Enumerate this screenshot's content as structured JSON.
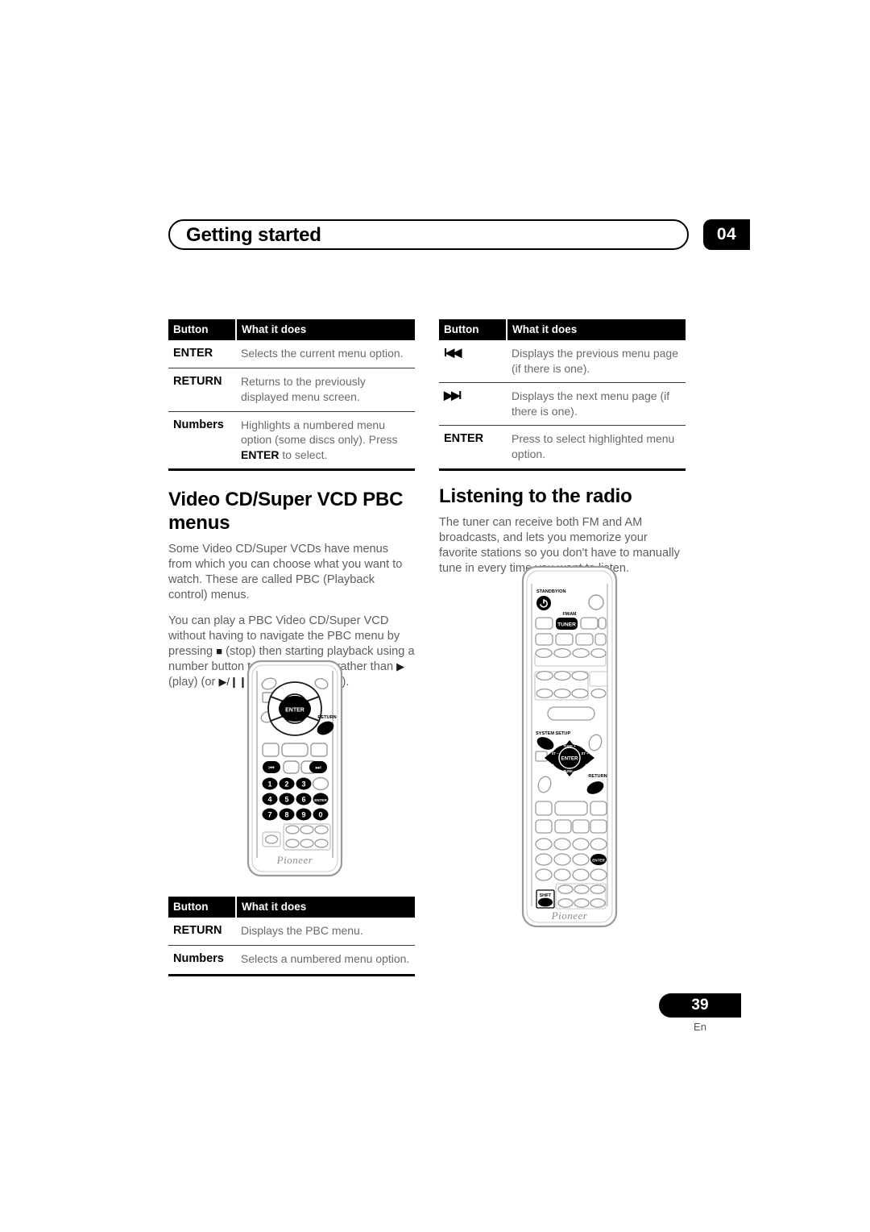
{
  "header": {
    "title": "Getting started",
    "chapter": "04"
  },
  "footer": {
    "page_number": "39",
    "language": "En"
  },
  "tables": {
    "columns": {
      "button": "Button",
      "what": "What it does"
    },
    "dvd_menu": [
      {
        "button": "ENTER",
        "desc": "Selects the current menu option.",
        "desc_bold": "",
        "desc_tail": ""
      },
      {
        "button": "RETURN",
        "desc": "Returns to the previously displayed menu screen.",
        "desc_bold": "",
        "desc_tail": ""
      },
      {
        "button": "Numbers",
        "desc": "Highlights a numbered menu option (some discs only). Press ",
        "desc_bold": "ENTER",
        "desc_tail": " to select."
      }
    ],
    "vcd_menu_right": [
      {
        "button": "Ɩ◀◀",
        "icon": "previous-track-icon",
        "desc": "Displays the previous menu page (if there is one)."
      },
      {
        "button": "▶▶Ɩ",
        "icon": "next-track-icon",
        "desc": "Displays the next menu page (if there is one)."
      },
      {
        "button": "ENTER",
        "icon": "",
        "desc": "Press to select highlighted menu option."
      }
    ],
    "pbc_menu": [
      {
        "button": "RETURN",
        "desc": "Displays the PBC menu."
      },
      {
        "button": "Numbers",
        "desc": "Selects a numbered menu option."
      }
    ]
  },
  "sections": {
    "vcd": {
      "heading": "Video CD/Super VCD PBC menus",
      "paragraph1": "Some Video CD/Super VCDs have menus from which you can choose what you want to watch. These are called PBC (Playback control) menus.",
      "p2_a": "You can play a PBC Video CD/Super VCD without having to navigate the PBC menu by pressing ",
      "p2_stop": "■",
      "p2_b": " (stop) then starting playback using a number button to select a track, rather than ",
      "p2_play": "▶",
      "p2_c": " (play) (or ",
      "p2_playpause": "▶/❙❙",
      "p2_d": " on the front panel)."
    },
    "radio": {
      "heading": "Listening to the radio",
      "paragraph1": "The tuner can receive both FM and AM broadcasts, and lets you memorize your favorite stations so you don't have to manually tune in every time you want to listen."
    }
  },
  "remote_left": {
    "name": "dvd-remote-control",
    "brand": "Pioneer",
    "labels": {
      "enter": "ENTER",
      "return": "RETURN",
      "prev": "Ɩ◀◀",
      "next": "▶▶Ɩ",
      "keypad_enter": "ENTER"
    },
    "number_keys": [
      "1",
      "2",
      "3",
      "4",
      "5",
      "6",
      "7",
      "8",
      "9",
      "0"
    ]
  },
  "remote_right": {
    "name": "tuner-remote-control",
    "brand": "Pioneer",
    "labels": {
      "standby": "STANDBY/ON",
      "fmam": "FM/AM",
      "tuner": "TUNER",
      "system_setup": "SYSTEM SETUP",
      "enter": "ENTER",
      "return": "RETURN",
      "tune_up": "TUNE +",
      "tune_down": "TUNE –",
      "st_up": "ST +",
      "st_down": "ST –",
      "shift": "SHIFT",
      "keypad_enter": "ENTER"
    }
  },
  "colors": {
    "ink": "#000000",
    "body_text": "#5e5e5e",
    "paper": "#ffffff",
    "remote_outline": "#8a8a8a"
  }
}
